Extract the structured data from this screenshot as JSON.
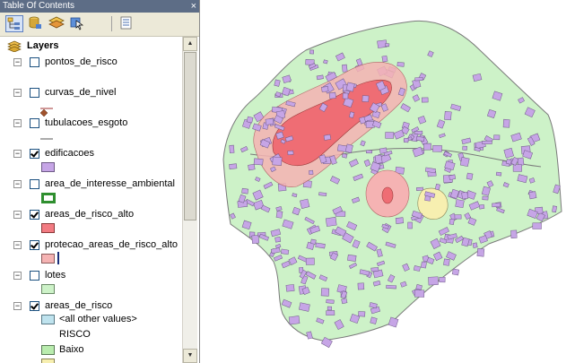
{
  "window": {
    "title": "Table Of Contents",
    "close_glyph": "×"
  },
  "toolbar": {
    "buttons": [
      {
        "icon": "list-by-drawing-order-icon",
        "active": true
      },
      {
        "icon": "list-by-source-icon"
      },
      {
        "icon": "list-by-visibility-icon"
      },
      {
        "icon": "list-by-selection-icon"
      },
      {
        "icon": "options-icon"
      }
    ]
  },
  "tree": {
    "root_label": "Layers",
    "layers": [
      {
        "name": "pontos_de_risco",
        "checked": false,
        "symbol": "point",
        "color": "#a0522d"
      },
      {
        "name": "curvas_de_nivel",
        "checked": false,
        "symbol": "line",
        "color": "#a03030"
      },
      {
        "name": "tubulacoes_esgoto",
        "checked": false,
        "symbol": "line",
        "color": "#555555"
      },
      {
        "name": "edificacoes",
        "checked": true,
        "symbol": "fill",
        "color": "#c6a5e6"
      },
      {
        "name": "area_de_interesse_ambiental",
        "checked": false,
        "symbol": "outline",
        "color": "#2f8f2f"
      },
      {
        "name": "areas_de_risco_alto",
        "checked": true,
        "symbol": "fill",
        "color": "#f27b82"
      },
      {
        "name": "protecao_areas_de_risco_alto",
        "checked": true,
        "symbol": "fill-bar",
        "color": "#f5b3b3"
      },
      {
        "name": "lotes",
        "checked": false,
        "symbol": "fill",
        "color": "#cdf2c8"
      },
      {
        "name": "areas_de_risco",
        "checked": true,
        "symbol": "classes",
        "classes": [
          {
            "label": "<all other values>",
            "color": "#bfe3ee"
          },
          {
            "label": "RISCO",
            "heading": true
          },
          {
            "label": "Baixo",
            "color": "#b9ecae"
          }
        ]
      }
    ]
  },
  "map": {
    "colors": {
      "lote": "#cdf2c8",
      "outline": "#7a7a7a",
      "building": "#c6a5e6",
      "building_stroke": "#6e5a86",
      "buffer": "#f5b3b3",
      "risk_high": "#ef6d74",
      "medium": "#f7efb0"
    }
  }
}
